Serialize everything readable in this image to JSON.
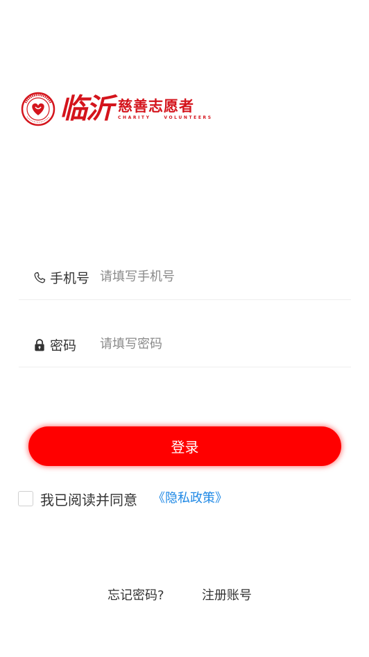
{
  "logo": {
    "city": "临沂",
    "name": "慈善志愿者",
    "subtitle": "CHARITY    VOLUNTEERS"
  },
  "phone_field": {
    "icon": "phone-icon",
    "label": "手机号",
    "placeholder": "请填写手机号",
    "value": ""
  },
  "password_field": {
    "icon": "lock-icon",
    "label": "密码",
    "placeholder": "请填写密码",
    "value": ""
  },
  "login_button": {
    "label": "登录"
  },
  "agreement": {
    "checked": false,
    "text": "我已阅读并同意",
    "privacy_link": "《隐私政策》"
  },
  "links": {
    "forgot_password": "忘记密码?",
    "register": "注册账号"
  },
  "colors": {
    "accent": "#ff0000",
    "brand": "#d4141c",
    "link": "#1e88e5"
  }
}
